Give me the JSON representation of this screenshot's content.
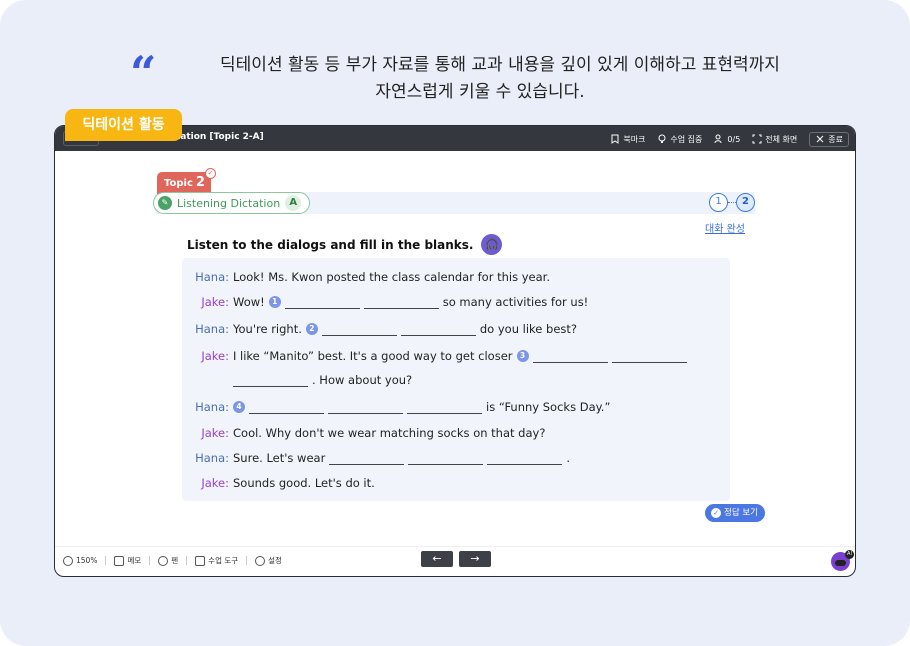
{
  "headline": {
    "line1": "딕테이션 활동 등 부가 자료를 통해 교과 내용을 깊이 있게 이해하고 표현력까지",
    "line2": "자연스럽게 키울 수 있습니다."
  },
  "tag_label": "딕테이션 활동",
  "window": {
    "title": "Listening Dictation [Topic 2-A]",
    "toolbar": [
      {
        "icon": "bookmark-icon",
        "label": "북마크"
      },
      {
        "icon": "lightbulb-icon",
        "label": "수업 집중"
      },
      {
        "icon": "users-icon",
        "label": "0/5"
      },
      {
        "icon": "fullscreen-icon",
        "label": "전체 화면"
      },
      {
        "icon": "close-icon",
        "label": "종료"
      }
    ]
  },
  "topic": {
    "label": "Topic",
    "number": "2"
  },
  "activity": {
    "title": "Listening Dictation",
    "letter": "A"
  },
  "steps": [
    "1",
    "2"
  ],
  "dialog_complete_link": "대화 완성",
  "instruction": "Listen to the dialogs and fill in the blanks.",
  "dialog": [
    {
      "speaker": "Hana:",
      "text": "Look! Ms. Kwon posted the class calendar for this year."
    },
    {
      "speaker": "Jake:",
      "before": "Wow!",
      "num": "1",
      "after": "so many activities for us!"
    },
    {
      "speaker": "Hana:",
      "before": "You're right.",
      "num": "2",
      "after": "do you like best?"
    },
    {
      "speaker": "Jake:",
      "before": "I like “Manito” best. It's a good way to get closer",
      "num": "3",
      "after": ". How about you?"
    },
    {
      "speaker": "Hana:",
      "num": "4",
      "after": "is “Funny Socks Day.”"
    },
    {
      "speaker": "Jake:",
      "text": "Cool. Why don't we wear matching socks on that day?"
    },
    {
      "speaker": "Hana:",
      "before": "Sure. Let's wear",
      "after": "."
    },
    {
      "speaker": "Jake:",
      "text": "Sounds good. Let's do it."
    }
  ],
  "answer_button": "정답 보기",
  "bottom": [
    {
      "icon": "zoom-icon",
      "label": "150%"
    },
    {
      "icon": "memo-icon",
      "label": "메모"
    },
    {
      "icon": "pen-icon",
      "label": "펜"
    },
    {
      "icon": "tools-icon",
      "label": "수업 도구"
    },
    {
      "icon": "settings-icon",
      "label": "설정"
    }
  ],
  "nav": {
    "prev": "←",
    "next": "→"
  },
  "ai_badge": "AI"
}
